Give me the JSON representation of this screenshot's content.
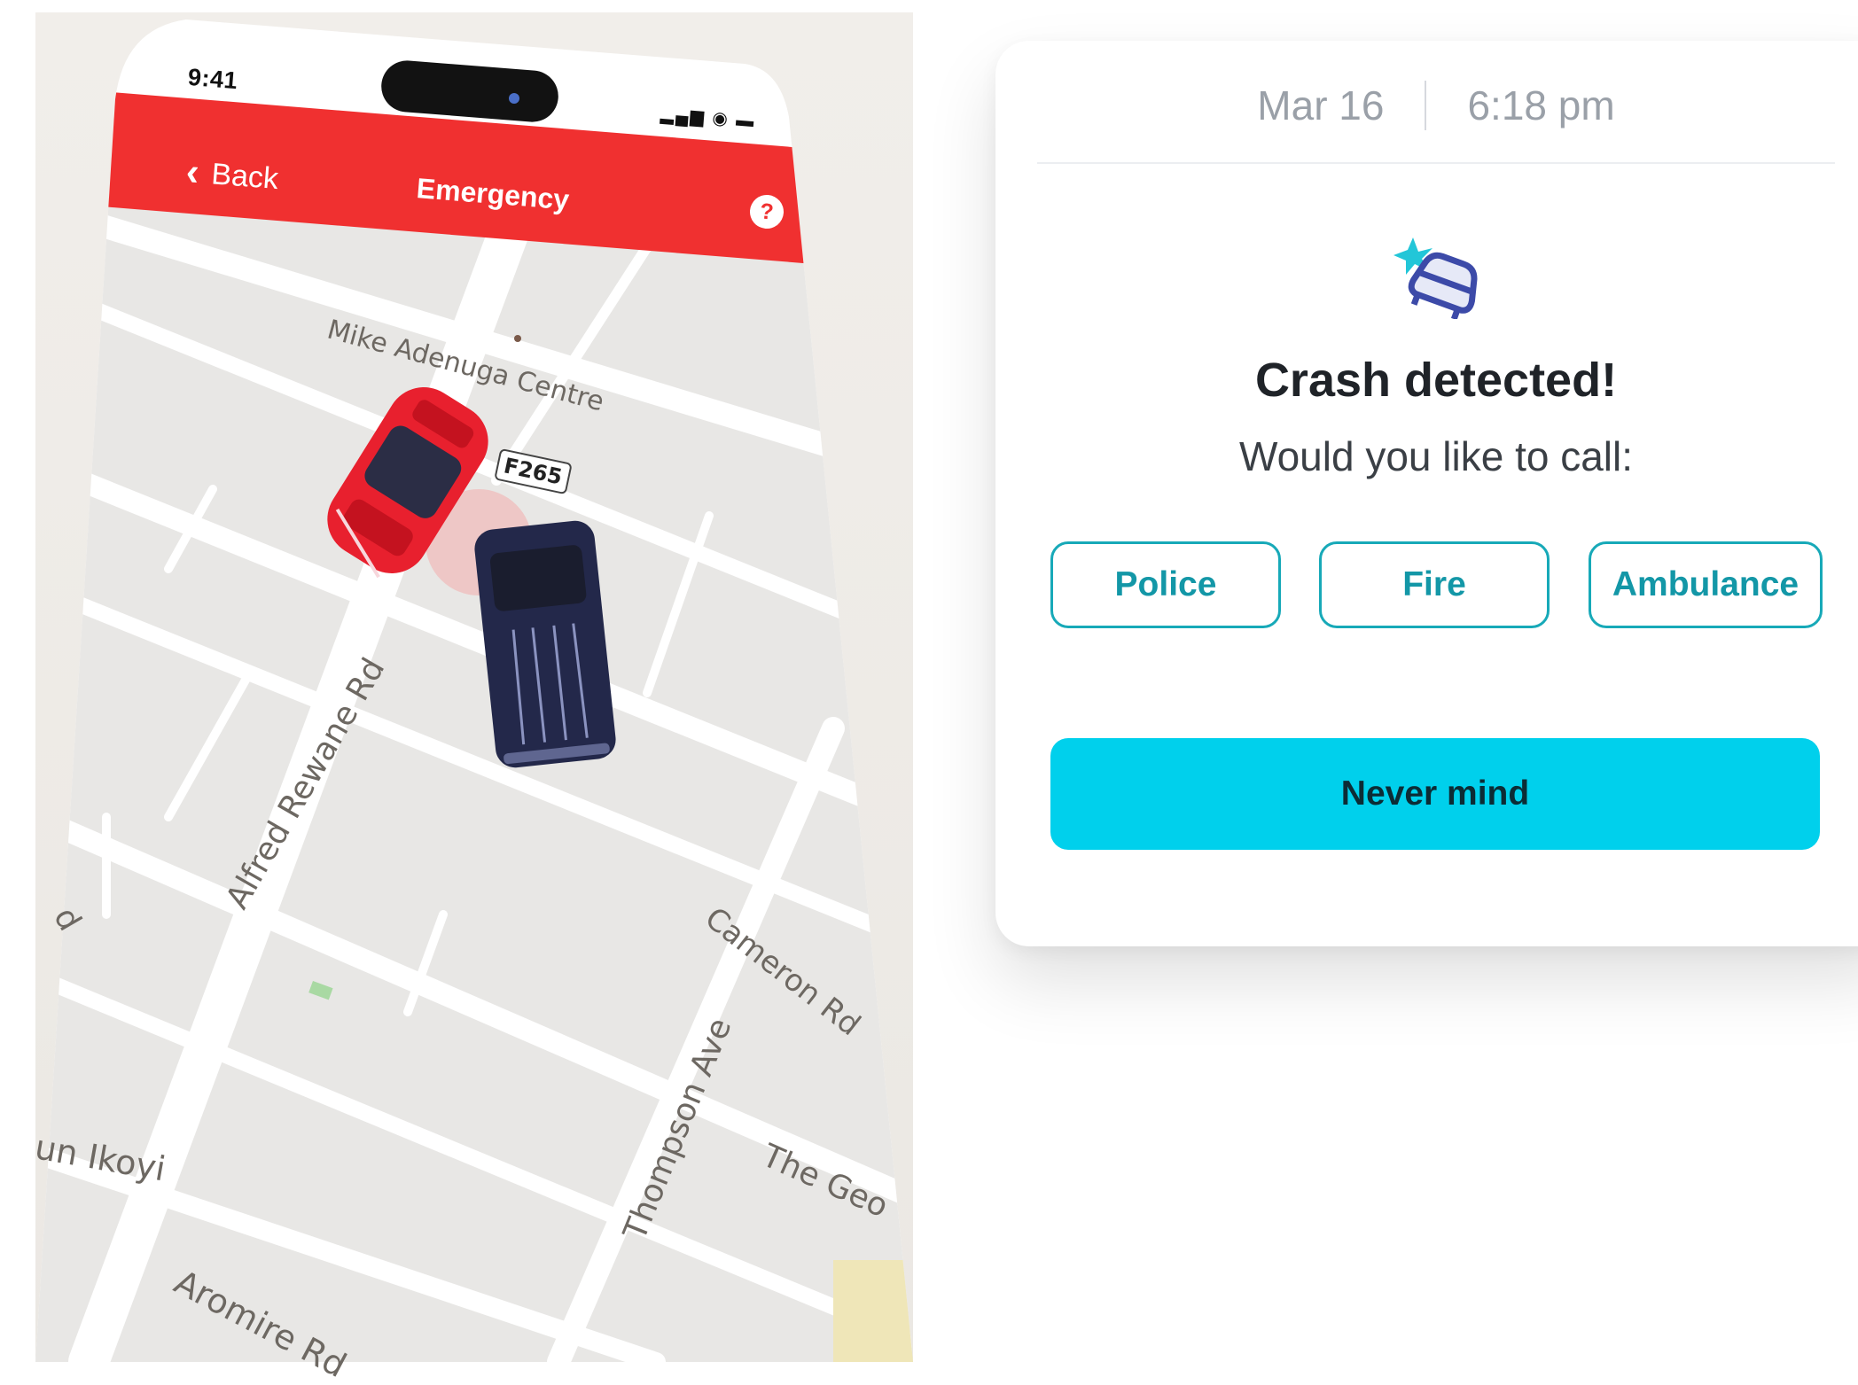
{
  "phone": {
    "status_bar": {
      "time": "9:41",
      "icons": "▂▄▆ ◉ ▬"
    },
    "header": {
      "back_label": "Back",
      "title": "Emergency",
      "help_icon": "?"
    },
    "map": {
      "labels": {
        "centre": "Mike Adenuga Centre",
        "alfred": "Alfred Rewane Rd",
        "cameron": "Cameron Rd",
        "thompson": "Thompson Ave",
        "ikoyi": "un Ikoyi",
        "aromire": "Aromire Rd",
        "geo": "The Geo",
        "rd_fragment": "d"
      },
      "plate": "F265"
    }
  },
  "alert": {
    "date": "Mar 16",
    "time": "6:18 pm",
    "icon": "car-crash-icon",
    "title": "Crash detected!",
    "subtitle": "Would you like to call:",
    "options": {
      "police": "Police",
      "fire": "Fire",
      "ambulance": "Ambulance"
    },
    "dismiss": "Never mind"
  },
  "colors": {
    "header_red": "#f03030",
    "accent_teal": "#17a9b8",
    "cta_cyan": "#00d0ec"
  }
}
